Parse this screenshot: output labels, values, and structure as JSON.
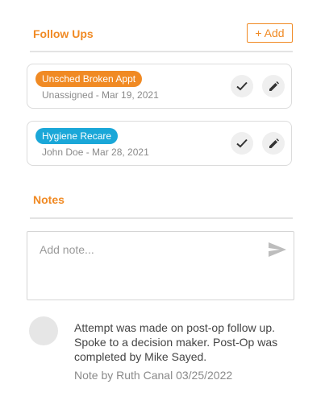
{
  "followups": {
    "title": "Follow Ups",
    "add_label": "+ Add",
    "items": [
      {
        "badge": "Unsched Broken Appt",
        "badge_color": "#f08a24",
        "meta": "Unassigned - Mar 19, 2021",
        "complete_icon": "check-icon",
        "edit_icon": "pencil-icon"
      },
      {
        "badge": "Hygiene Recare",
        "badge_color": "#1aa7d8",
        "meta": "John Doe - Mar 28, 2021",
        "complete_icon": "check-icon",
        "edit_icon": "pencil-icon"
      }
    ]
  },
  "notes": {
    "title": "Notes",
    "input_placeholder": "Add note...",
    "send_icon": "send-icon",
    "entries": [
      {
        "text": "Attempt was made on post-op follow up. Spoke to a decision maker. Post-Op was completed by Mike Sayed.",
        "byline": "Note by Ruth Canal 03/25/2022"
      }
    ]
  },
  "colors": {
    "accent": "#f08a24",
    "blue_badge": "#1aa7d8"
  }
}
